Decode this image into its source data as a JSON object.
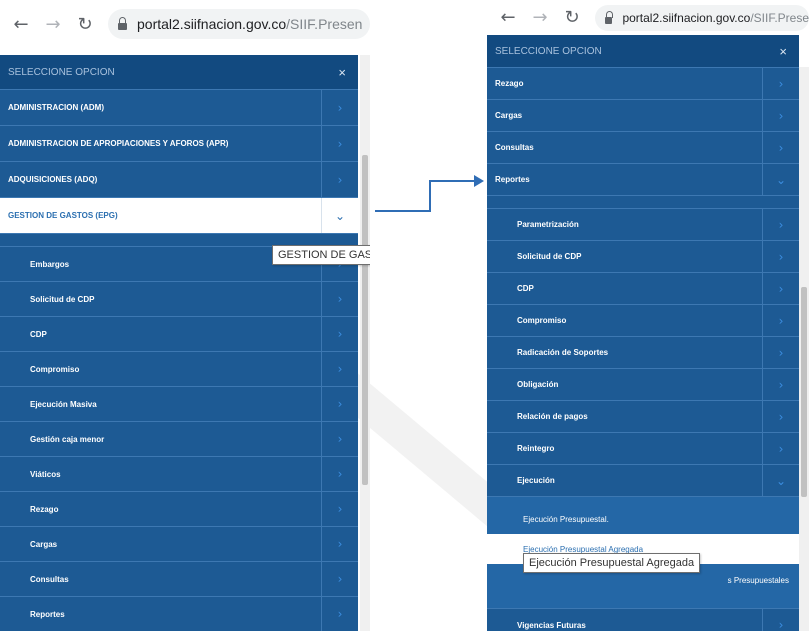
{
  "browser": {
    "left": {
      "host": "portal2.siifnacion.gov.co",
      "path": "/SIIF.Presen"
    },
    "right": {
      "host": "portal2.siifnacion.gov.co",
      "path": "/SIIF.Prese"
    }
  },
  "left_menu": {
    "header": "SELECCIONE OPCION",
    "close": "×",
    "items": [
      {
        "label": "ADMINISTRACION (ADM)"
      },
      {
        "label": "ADMINISTRACION DE APROPIACIONES Y AFOROS (APR)"
      },
      {
        "label": "ADQUISICIONES (ADQ)"
      },
      {
        "label": "GESTION DE GASTOS (EPG)"
      }
    ],
    "subitems": [
      {
        "label": "Embargos"
      },
      {
        "label": "Solicitud de CDP"
      },
      {
        "label": "CDP"
      },
      {
        "label": "Compromiso"
      },
      {
        "label": "Ejecución Masiva"
      },
      {
        "label": "Gestión caja menor"
      },
      {
        "label": "Viáticos"
      },
      {
        "label": "Rezago"
      },
      {
        "label": "Cargas"
      },
      {
        "label": "Consultas"
      },
      {
        "label": "Reportes"
      }
    ],
    "tooltip": "GESTION DE GAS"
  },
  "right_menu": {
    "header": "SELECCIONE OPCION",
    "close": "×",
    "items": [
      {
        "label": "Rezago"
      },
      {
        "label": "Cargas"
      },
      {
        "label": "Consultas"
      },
      {
        "label": "Reportes"
      }
    ],
    "subitems": [
      {
        "label": "Parametrización"
      },
      {
        "label": "Solicitud de CDP"
      },
      {
        "label": "CDP"
      },
      {
        "label": "Compromiso"
      },
      {
        "label": "Radicación de Soportes"
      },
      {
        "label": "Obligación"
      },
      {
        "label": "Relación de pagos"
      },
      {
        "label": "Reintegro"
      },
      {
        "label": "Ejecución"
      }
    ],
    "subsubitems": [
      {
        "label": "Ejecución Presupuestal."
      },
      {
        "label": "Ejecución Presupuestal Agregada"
      },
      {
        "label": "s Presupuestales"
      }
    ],
    "after": [
      {
        "label": "Vigencias Futuras"
      }
    ],
    "tooltip": "Ejecución Presupuestal Agregada"
  },
  "icons": {
    "back": "arrow-left-icon",
    "forward": "arrow-right-icon",
    "reload": "reload-icon",
    "lock": "lock-icon",
    "chevron": "chevron-right-icon",
    "chevron_open": "chevron-down-icon"
  },
  "colors": {
    "menu_bg": "#1d5a94",
    "menu_header": "#124a80",
    "divider": "#3d78b2",
    "chevron": "#3c8ee0",
    "active_text": "#2b6fb0",
    "arrow": "#2f6db5"
  }
}
